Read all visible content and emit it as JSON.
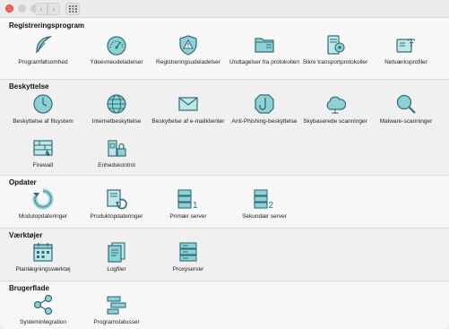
{
  "window": {
    "controls": [
      "close",
      "minimize",
      "zoom"
    ]
  },
  "toolbar": {
    "back_icon": "chevron-left-icon",
    "forward_icon": "chevron-right-icon",
    "grid_icon": "grid-icon"
  },
  "colors": {
    "icon_stroke": "#2f6f78",
    "icon_fill": "#8fd0d4",
    "icon_fill_light": "#bfe6e8"
  },
  "sections": [
    {
      "title": "Registreringsprogram",
      "items": [
        {
          "label": "Programfølsomhed",
          "icon": "feather-icon"
        },
        {
          "label": "Ydeevneudeladelser",
          "icon": "gauge-icon"
        },
        {
          "label": "Registreringsudeladelser",
          "icon": "warning-shield-icon"
        },
        {
          "label": "Undtagelser fra protokollen",
          "icon": "folder-icon"
        },
        {
          "label": "Sikre transportprotokoller",
          "icon": "secure-server-icon"
        },
        {
          "label": "Netværksprofiler",
          "icon": "network-profile-icon"
        }
      ]
    },
    {
      "title": "Beskyttelse",
      "items": [
        {
          "label": "Beskyttelse af filsystem",
          "icon": "clock-icon"
        },
        {
          "label": "Internetbeskyttelse",
          "icon": "globe-icon"
        },
        {
          "label": "Beskyttelse af e-mailklienter",
          "icon": "envelope-icon"
        },
        {
          "label": "Anti-Phishing-beskyttelse",
          "icon": "hook-icon"
        },
        {
          "label": "Skybaserede scanninger",
          "icon": "cloud-icon"
        },
        {
          "label": "Malware-scanninger",
          "icon": "magnifier-icon"
        },
        {
          "label": "Firewall",
          "icon": "firewall-icon"
        },
        {
          "label": "Enhedskontrol",
          "icon": "device-lock-icon"
        }
      ]
    },
    {
      "title": "Opdater",
      "items": [
        {
          "label": "Modulopdateringer",
          "icon": "refresh-icon"
        },
        {
          "label": "Produktopdateringer",
          "icon": "product-update-icon"
        },
        {
          "label": "Primær server",
          "icon": "server-1-icon"
        },
        {
          "label": "Sekundær server",
          "icon": "server-2-icon"
        }
      ]
    },
    {
      "title": "Værktøjer",
      "items": [
        {
          "label": "Planlægningsværktøj",
          "icon": "calendar-icon"
        },
        {
          "label": "Logfiler",
          "icon": "log-files-icon"
        },
        {
          "label": "Proxyserver",
          "icon": "proxy-server-icon"
        }
      ]
    },
    {
      "title": "Brugerflade",
      "items": [
        {
          "label": "Systemintegration",
          "icon": "share-icon"
        },
        {
          "label": "Programstatusser",
          "icon": "status-bars-icon"
        }
      ]
    }
  ]
}
